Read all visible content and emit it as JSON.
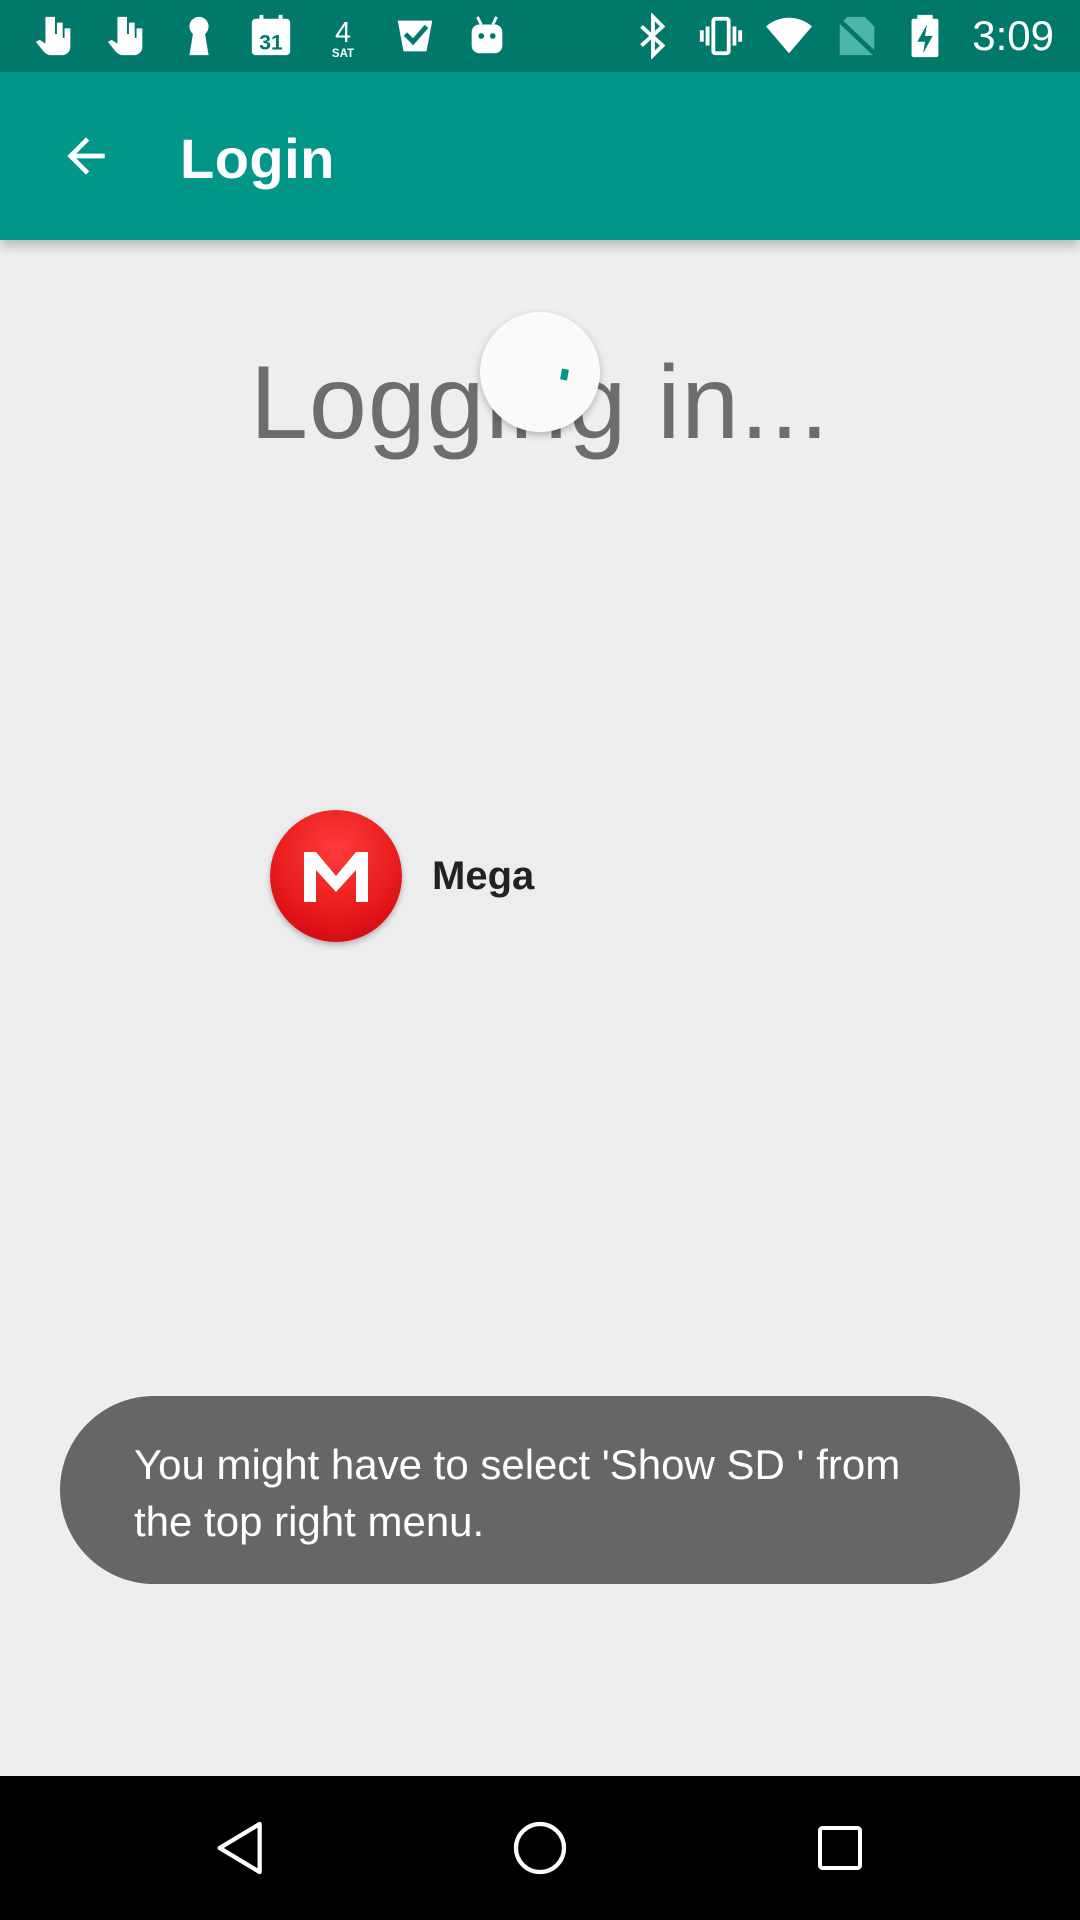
{
  "status_bar": {
    "time": "3:09",
    "calendar_day": "31",
    "weather_day_number": "4",
    "weather_day_label": "SAT",
    "left_icons": [
      "notification-hand-icon",
      "notification-hand-icon",
      "keyhole-icon",
      "calendar-icon",
      "weather-date-icon",
      "checkmark-app-icon",
      "android-robot-icon"
    ],
    "right_icons": [
      "bluetooth-icon",
      "vibrate-icon",
      "wifi-icon",
      "no-sim-icon",
      "battery-charging-icon"
    ]
  },
  "app_bar": {
    "title": "Login",
    "back_icon": "arrow-back-icon",
    "color": "#009688"
  },
  "content": {
    "status_text": "Logging in...",
    "spinner_color": "#009688",
    "account": {
      "name": "Mega",
      "logo_letter": "M",
      "logo_color": "#e81c1c"
    }
  },
  "toast": {
    "message": "You might have to select 'Show SD ' from the top right menu."
  },
  "nav_bar": {
    "buttons": [
      "back-triangle-icon",
      "home-circle-icon",
      "recents-square-icon"
    ]
  }
}
